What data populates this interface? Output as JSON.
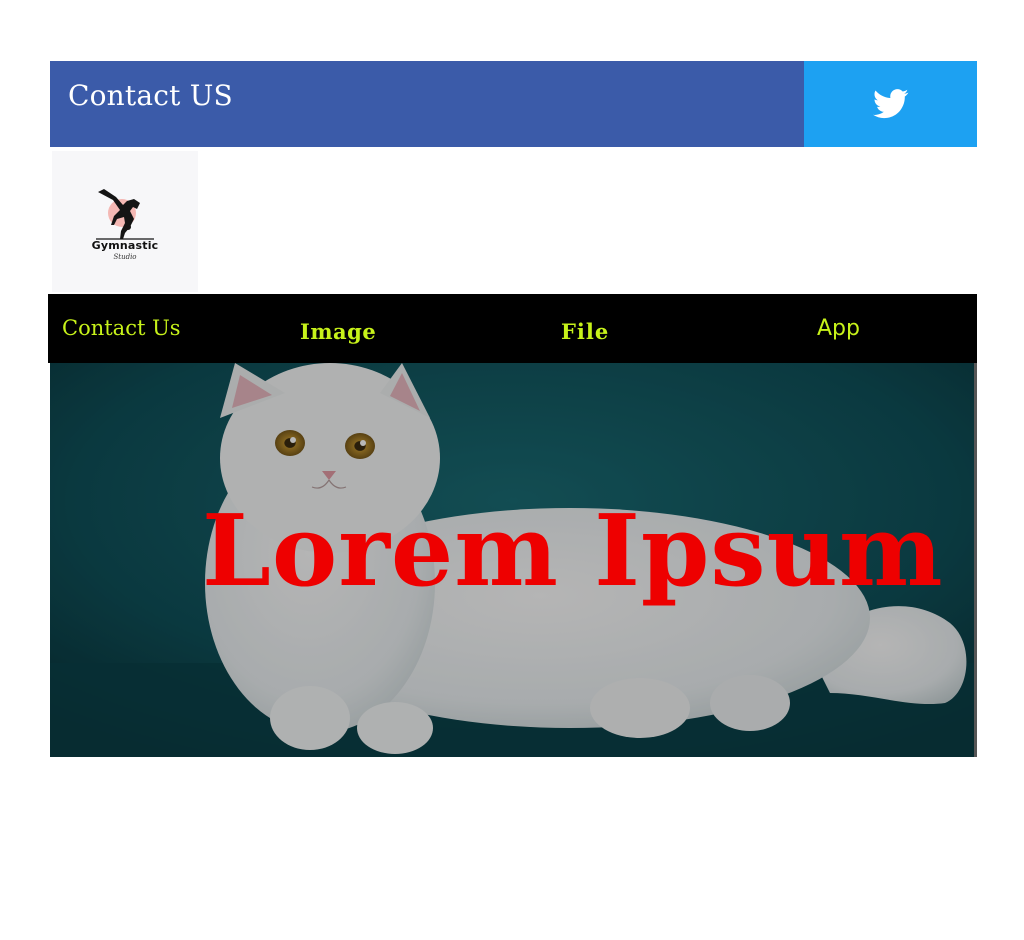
{
  "header": {
    "title": "Contact US",
    "social_icon": "twitter-bird-icon",
    "colors": {
      "left_bg": "#3b5ba9",
      "right_bg": "#1da1f2"
    }
  },
  "logo": {
    "brand_name": "Gymnastic",
    "tagline": "Studio"
  },
  "nav": {
    "items": [
      {
        "label": "Contact Us"
      },
      {
        "label": "Image"
      },
      {
        "label": "File"
      },
      {
        "label": "App"
      }
    ],
    "colors": {
      "bg": "#000000",
      "text": "#c7f21a"
    }
  },
  "hero": {
    "heading": "Lorem Ipsum",
    "background_subject": "white cat on teal backdrop",
    "colors": {
      "heading": "#ee0000",
      "backdrop": "#0d3d44"
    }
  }
}
